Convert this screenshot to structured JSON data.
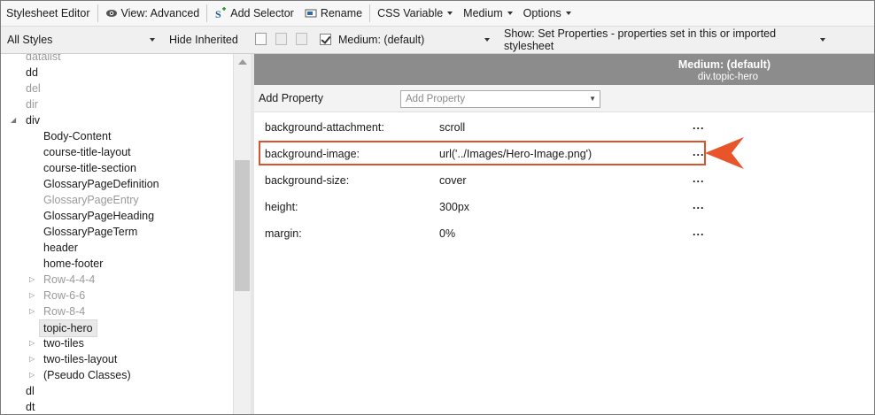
{
  "toolbar": {
    "stylesheet_editor": "Stylesheet Editor",
    "view": "View: Advanced",
    "add_selector": "Add Selector",
    "rename": "Rename",
    "css_variable": "CSS Variable",
    "medium": "Medium",
    "options": "Options"
  },
  "filter_bar": {
    "styles_combo": "All Styles",
    "hide_inherited": "Hide Inherited",
    "medium_combo": "Medium: (default)",
    "show_combo": "Show: Set Properties - properties set in this or imported stylesheet"
  },
  "tree": [
    {
      "label": "datalist",
      "level": 0,
      "expander": "none",
      "dim": true
    },
    {
      "label": "dd",
      "level": 0,
      "expander": "none",
      "dim": false
    },
    {
      "label": "del",
      "level": 0,
      "expander": "none",
      "dim": true
    },
    {
      "label": "dir",
      "level": 0,
      "expander": "none",
      "dim": true
    },
    {
      "label": "div",
      "level": 0,
      "expander": "expanded",
      "dim": false
    },
    {
      "label": "Body-Content",
      "level": 1,
      "expander": "none",
      "dim": false
    },
    {
      "label": "course-title-layout",
      "level": 1,
      "expander": "none",
      "dim": false
    },
    {
      "label": "course-title-section",
      "level": 1,
      "expander": "none",
      "dim": false
    },
    {
      "label": "GlossaryPageDefinition",
      "level": 1,
      "expander": "none",
      "dim": false
    },
    {
      "label": "GlossaryPageEntry",
      "level": 1,
      "expander": "none",
      "dim": true
    },
    {
      "label": "GlossaryPageHeading",
      "level": 1,
      "expander": "none",
      "dim": false
    },
    {
      "label": "GlossaryPageTerm",
      "level": 1,
      "expander": "none",
      "dim": false
    },
    {
      "label": "header",
      "level": 1,
      "expander": "none",
      "dim": false
    },
    {
      "label": "home-footer",
      "level": 1,
      "expander": "none",
      "dim": false
    },
    {
      "label": "Row-4-4-4",
      "level": 1,
      "expander": "collapsed",
      "dim": true
    },
    {
      "label": "Row-6-6",
      "level": 1,
      "expander": "collapsed",
      "dim": true
    },
    {
      "label": "Row-8-4",
      "level": 1,
      "expander": "collapsed",
      "dim": true
    },
    {
      "label": "topic-hero",
      "level": 1,
      "expander": "none",
      "dim": false,
      "selected": true
    },
    {
      "label": "two-tiles",
      "level": 1,
      "expander": "collapsed",
      "dim": false
    },
    {
      "label": "two-tiles-layout",
      "level": 1,
      "expander": "collapsed",
      "dim": false
    },
    {
      "label": "(Pseudo Classes)",
      "level": 1,
      "expander": "collapsed",
      "dim": false
    },
    {
      "label": "dl",
      "level": 0,
      "expander": "none",
      "dim": false
    },
    {
      "label": "dt",
      "level": 0,
      "expander": "none",
      "dim": false
    }
  ],
  "panel": {
    "header_title": "Medium: (default)",
    "header_selector": "div.topic-hero",
    "add_property_label": "Add Property",
    "add_property_placeholder": "Add Property",
    "ellipsis": "...",
    "properties": [
      {
        "name": "background-attachment:",
        "value": "scroll"
      },
      {
        "name": "background-image:",
        "value": "url('../Images/Hero-Image.png')"
      },
      {
        "name": "background-size:",
        "value": "cover"
      },
      {
        "name": "height:",
        "value": "300px"
      },
      {
        "name": "margin:",
        "value": "0%"
      }
    ]
  },
  "colors": {
    "highlight": "#d9542b",
    "header_bg": "#8c8c8c"
  },
  "icons": {
    "view": "eye-icon",
    "add_selector": "add-selector-icon",
    "rename": "rename-icon"
  }
}
